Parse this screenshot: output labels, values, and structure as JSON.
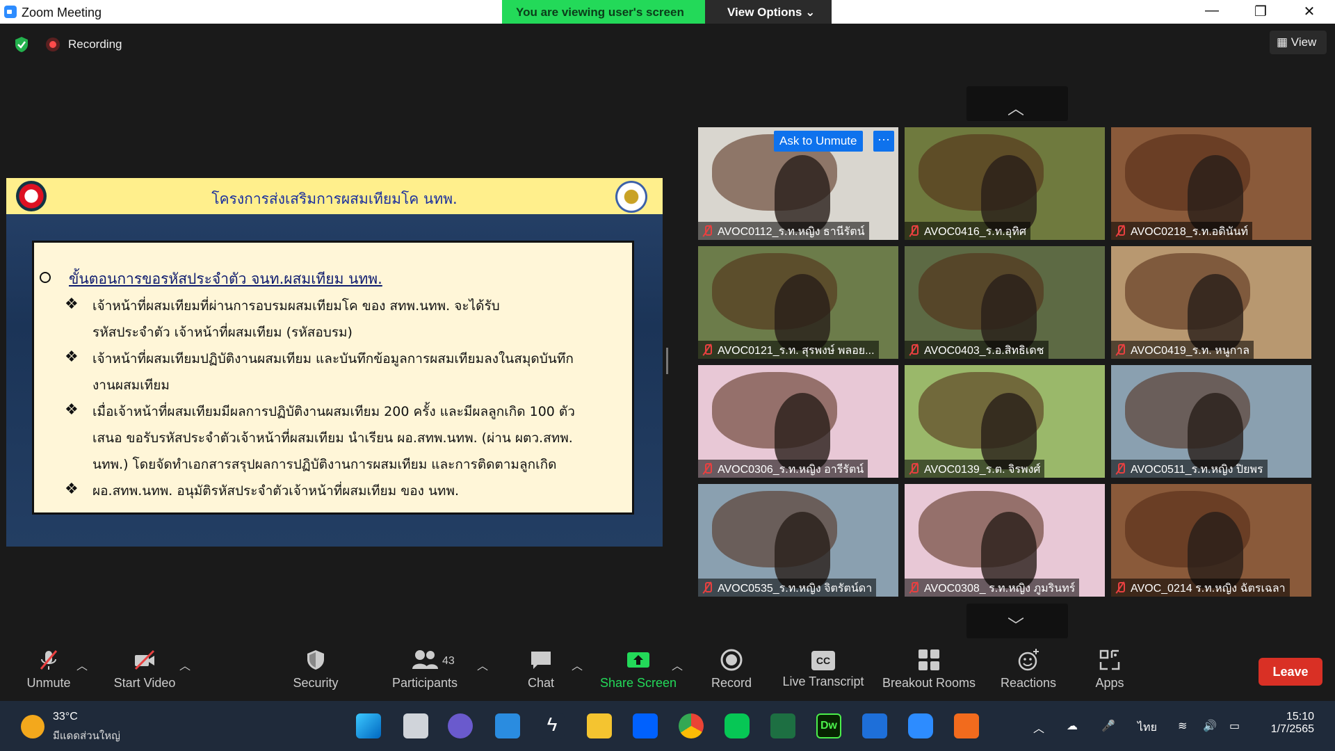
{
  "window": {
    "title": "Zoom Meeting",
    "minimize": "—",
    "maximize": "❐",
    "close": "✕"
  },
  "banner": {
    "viewing": "You are viewing user's screen",
    "view_options": "View Options ⌄"
  },
  "top": {
    "recording": "Recording",
    "view": "View"
  },
  "slide": {
    "header": "โครงการส่งเสริมการผสมเทียมโค นทพ.",
    "heading": "ขั้นตอนการขอรหัสประจำตัว จนท.ผสมเทียม นทพ.",
    "lines": [
      "เจ้าหน้าที่ผสมเทียมที่ผ่านการอบรมผสมเทียมโค ของ สทพ.นทพ. จะได้รับ",
      "รหัสประจำตัว เจ้าหน้าที่ผสมเทียม (รหัสอบรม)",
      "เจ้าหน้าที่ผสมเทียมปฏิบัติงานผสมเทียม และบันทึกข้อมูลการผสมเทียมลงในสมุดบันทึก",
      "งานผสมเทียม",
      "เมื่อเจ้าหน้าที่ผสมเทียมมีผลการปฏิบัติงานผสมเทียม 200 ครั้ง และมีผลลูกเกิด  100 ตัว",
      "เสนอ ขอรับรหัสประจำตัวเจ้าหน้าที่ผสมเทียม นำเรียน ผอ.สทพ.นทพ. (ผ่าน ผตว.สทพ.",
      "นทพ.) โดยจัดทำเอกสารสรุปผลการปฏิบัติงานการผสมเทียม และการติดตามลูกเกิด",
      "ผอ.สทพ.นทพ. อนุมัติรหัสประจำตัวเจ้าหน้าที่ผสมเทียม ของ นทพ."
    ],
    "bullet": "❖"
  },
  "ask_to_unmute": "Ask to Unmute",
  "more": "···",
  "participants": [
    {
      "name": "AVOC0112_ร.ท.หญิง ธานีรัตน์",
      "bg": "#d9d6cf"
    },
    {
      "name": "AVOC0416_ร.ท.อุทิศ",
      "bg": "#6f7a3e"
    },
    {
      "name": "AVOC0218_ร.ท.อดินันท์",
      "bg": "#8a5a3a"
    },
    {
      "name": "AVOC0121_ร.ท. สุรพงษ์  พลอย...",
      "bg": "#6c7c4a"
    },
    {
      "name": "AVOC0403_ร.อ.สิทธิเดช",
      "bg": "#5d6a44"
    },
    {
      "name": "AVOC0419_ร.ท. หนูกาล",
      "bg": "#b89870"
    },
    {
      "name": "AVOC0306_ร.ท.หญิง อารีรัตน์",
      "bg": "#e8c8d6"
    },
    {
      "name": "AVOC0139_ร.ต. จิรพงศ์",
      "bg": "#9ab86a"
    },
    {
      "name": "AVOC0511_ร.ท.หญิง ปิยพร",
      "bg": "#8aa0b0"
    },
    {
      "name": "AVOC0535_ร.ท.หญิง จิตรัตน์ดา",
      "bg": "#8aa0b0"
    },
    {
      "name": "AVOC0308_ ร.ท.หญิง ภูมรินทร์",
      "bg": "#e8c8d6"
    },
    {
      "name": "AVOC_0214 ร.ท.หญิง ฉัตรเฉลา",
      "bg": "#8a5a3a"
    }
  ],
  "toolbar": {
    "unmute": "Unmute",
    "start_video": "Start Video",
    "security": "Security",
    "participants": "Participants",
    "participants_count": "43",
    "chat": "Chat",
    "share_screen": "Share Screen",
    "record": "Record",
    "live_transcript": "Live Transcript",
    "breakout_rooms": "Breakout Rooms",
    "reactions": "Reactions",
    "apps": "Apps",
    "leave": "Leave",
    "cc": "CC"
  },
  "taskbar": {
    "temp": "33°C",
    "condition": "มีแดดส่วนใหญ่",
    "lang": "ไทย",
    "time": "15:10",
    "date": "1/7/2565",
    "dw": "Dw"
  },
  "colors": {
    "accent": "#0e72ed",
    "share": "#23d959",
    "leave": "#d93025",
    "banner": "#23d959"
  }
}
